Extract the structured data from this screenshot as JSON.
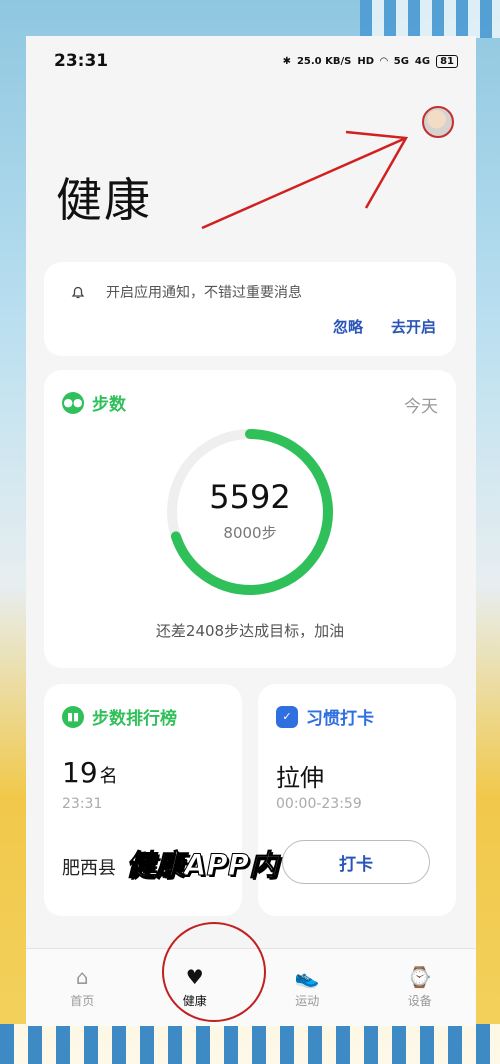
{
  "status_bar": {
    "time": "23:31",
    "net_speed": "25.0 KB/S",
    "hd": "HD",
    "signal1": "5G",
    "signal2": "4G",
    "battery": "81"
  },
  "header": {
    "title": "健康"
  },
  "notification": {
    "text": "开启应用通知，不错过重要消息",
    "ignore": "忽略",
    "enable": "去开启"
  },
  "steps": {
    "title": "步数",
    "period": "今天",
    "count": "5592",
    "goal": "8000步",
    "progress": 0.699,
    "tip": "还差2408步达成目标，加油",
    "accent": "#2fc05a"
  },
  "ranking": {
    "title": "步数排行榜",
    "rank": "19",
    "rank_unit": "名",
    "time": "23:31",
    "area": "肥西县"
  },
  "habit": {
    "title": "习惯打卡",
    "name": "拉伸",
    "time": "00:00-23:59",
    "button": "打卡"
  },
  "overlay": "健康APP内",
  "nav": [
    {
      "label": "首页",
      "icon": "home-icon"
    },
    {
      "label": "健康",
      "icon": "heart-icon"
    },
    {
      "label": "运动",
      "icon": "shoe-icon"
    },
    {
      "label": "设备",
      "icon": "watch-icon"
    }
  ]
}
